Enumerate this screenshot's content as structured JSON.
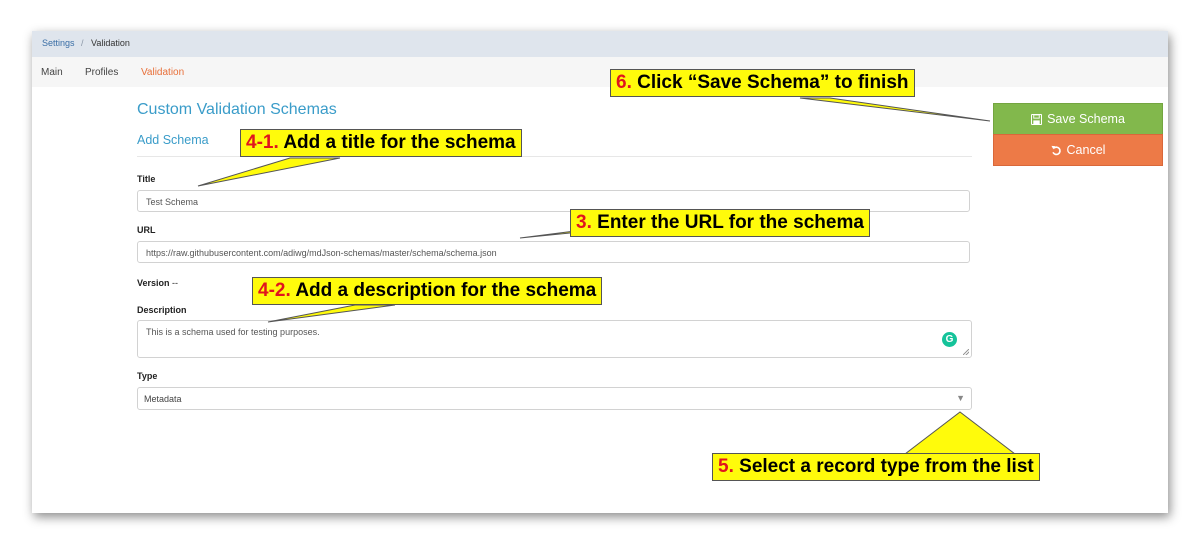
{
  "breadcrumb": {
    "settings": "Settings",
    "separator": "/",
    "current": "Validation"
  },
  "tabs": [
    {
      "label": "Main"
    },
    {
      "label": "Profiles"
    },
    {
      "label": "Validation"
    }
  ],
  "page": {
    "heading": "Custom Validation Schemas",
    "subheading": "Add Schema"
  },
  "form": {
    "title_label": "Title",
    "title_value": "Test Schema",
    "url_label": "URL",
    "url_value": "https://raw.githubusercontent.com/adiwg/mdJson-schemas/master/schema/schema.json",
    "version_label": "Version",
    "version_value": "--",
    "description_label": "Description",
    "description_value": "This is a schema used for testing purposes.",
    "type_label": "Type",
    "type_value": "Metadata"
  },
  "buttons": {
    "save_label": "Save Schema",
    "cancel_label": "Cancel"
  },
  "callouts": {
    "c6_num": "6.",
    "c6_text": "Click “Save Schema” to finish",
    "c41_num": "4-1.",
    "c41_text": "Add a title for the schema",
    "c3_num": "3.",
    "c3_text": "Enter the URL for the schema",
    "c42_num": "4-2.",
    "c42_text": "Add a description for the schema",
    "c5_num": "5.",
    "c5_text": "Select a record type from the list"
  },
  "colors": {
    "accent": "#3a9cc9",
    "active_tab": "#e8703a",
    "save": "#82b84c",
    "cancel": "#ed7a47",
    "callout": "#fffb0b"
  },
  "icons": [
    "save-icon",
    "undo-icon",
    "grammarly-icon",
    "dropdown-arrow-icon"
  ]
}
